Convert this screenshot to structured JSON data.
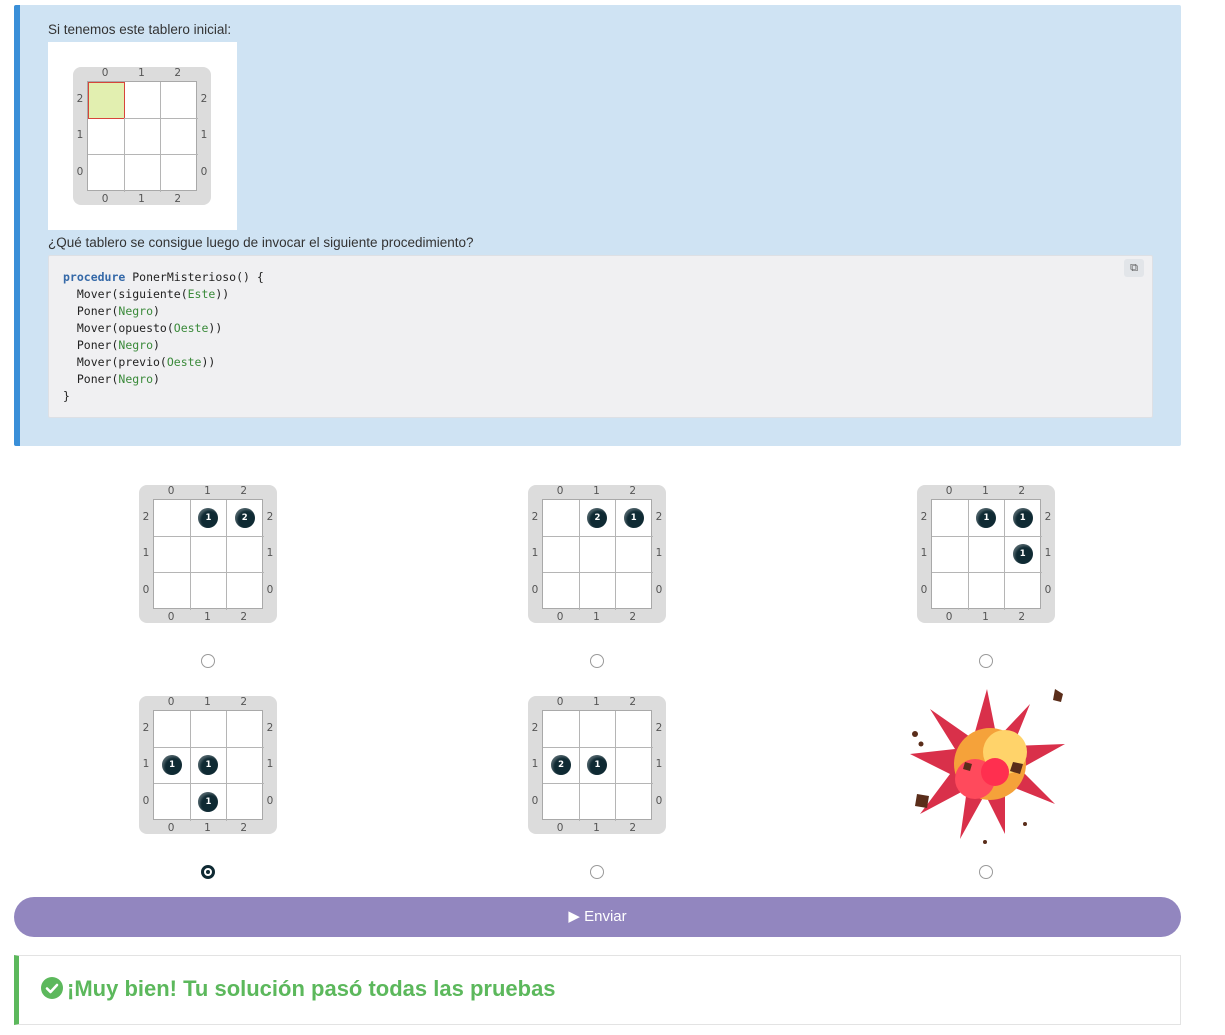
{
  "statement": {
    "intro": "Si tenemos este tablero inicial:",
    "question": "¿Qué tablero se consigue luego de invocar el siguiente procedimiento?",
    "code_lines": [
      {
        "kw": "procedure",
        "rest": " PonerMisterioso() {"
      },
      {
        "pre": "  Mover(siguiente(",
        "arg": "Este",
        "post": "))"
      },
      {
        "pre": "  Poner(",
        "arg": "Negro",
        "post": ")"
      },
      {
        "pre": "  Mover(opuesto(",
        "arg": "Oeste",
        "post": "))"
      },
      {
        "pre": "  Poner(",
        "arg": "Negro",
        "post": ")"
      },
      {
        "pre": "  Mover(previo(",
        "arg": "Oeste",
        "post": "))"
      },
      {
        "pre": "  Poner(",
        "arg": "Negro",
        "post": ")"
      },
      {
        "pre": "}",
        "arg": "",
        "post": ""
      }
    ],
    "copy_icon": "copy-icon"
  },
  "axis_labels": [
    "0",
    "1",
    "2"
  ],
  "initial_board": {
    "selected": {
      "x": 0,
      "y": 2
    },
    "balls": []
  },
  "options": [
    {
      "balls": [
        {
          "x": 1,
          "y": 2,
          "n": "1"
        },
        {
          "x": 2,
          "y": 2,
          "n": "2"
        }
      ],
      "checked": false
    },
    {
      "balls": [
        {
          "x": 1,
          "y": 2,
          "n": "2"
        },
        {
          "x": 2,
          "y": 2,
          "n": "1"
        }
      ],
      "checked": false
    },
    {
      "balls": [
        {
          "x": 1,
          "y": 2,
          "n": "1"
        },
        {
          "x": 2,
          "y": 2,
          "n": "1"
        },
        {
          "x": 2,
          "y": 1,
          "n": "1"
        }
      ],
      "checked": false
    },
    {
      "balls": [
        {
          "x": 0,
          "y": 1,
          "n": "1"
        },
        {
          "x": 1,
          "y": 1,
          "n": "1"
        },
        {
          "x": 1,
          "y": 0,
          "n": "1"
        }
      ],
      "checked": true
    },
    {
      "balls": [
        {
          "x": 0,
          "y": 1,
          "n": "2"
        },
        {
          "x": 1,
          "y": 1,
          "n": "1"
        }
      ],
      "checked": false
    },
    {
      "explosion": true,
      "icon": "explosion-icon",
      "checked": false
    }
  ],
  "submit": {
    "label": "Enviar",
    "icon": "play-icon"
  },
  "feedback": {
    "text": "¡Muy bien! Tu solución pasó todas las pruebas",
    "icon": "check-circle-icon",
    "color": "#5cb85c"
  },
  "colors": {
    "accent": "#9286bf",
    "statement_bg": "#cfe3f3",
    "statement_border": "#3a8fd8",
    "ball": "#0f2a33"
  }
}
